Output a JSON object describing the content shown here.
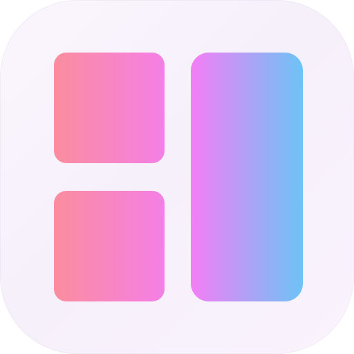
{
  "icon": {
    "name": "collage-layout-app-icon",
    "background_color": "#f8f2fc",
    "tiles": [
      {
        "name": "top-left-tile",
        "gradient": [
          "#fb8d9e",
          "#f47fe6"
        ]
      },
      {
        "name": "bottom-left-tile",
        "gradient": [
          "#fb8d9e",
          "#f47fe6"
        ]
      },
      {
        "name": "right-tall-tile",
        "gradient": [
          "#f47ef6",
          "#6cc3f6"
        ]
      }
    ]
  }
}
